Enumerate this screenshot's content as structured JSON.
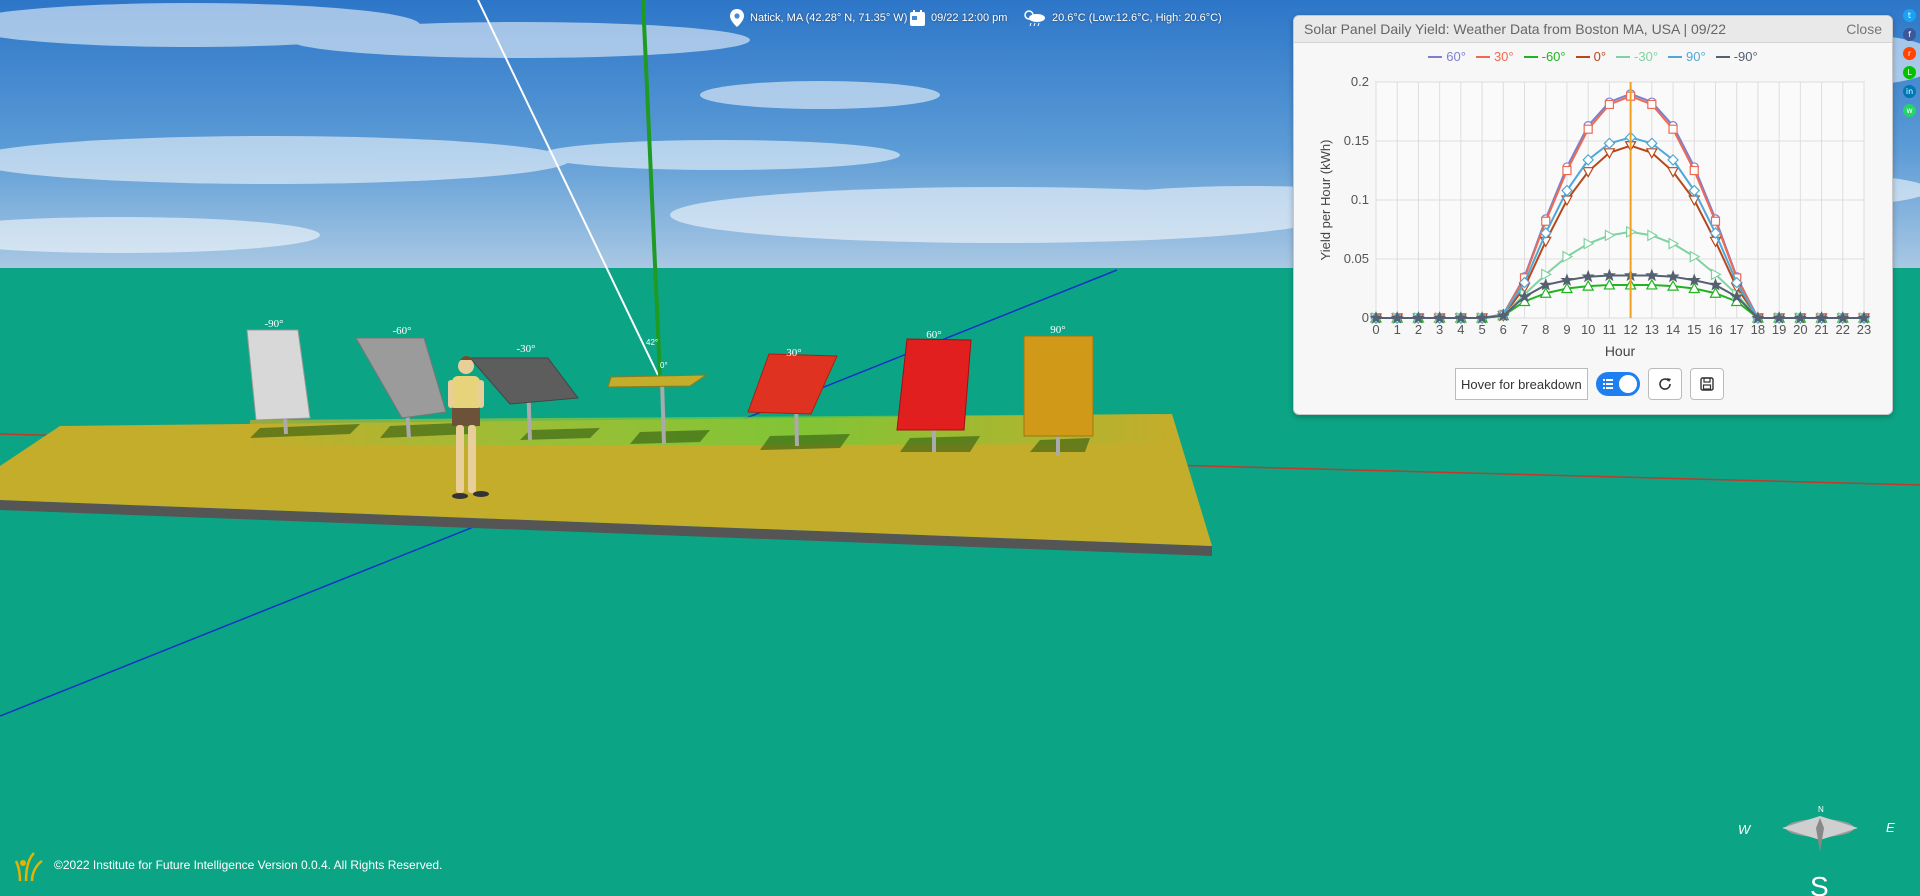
{
  "info": {
    "location": "Natick, MA (42.28° N, 71.35° W)",
    "datetime": "09/22 12:00 pm",
    "weather": "20.6°C (Low:12.6°C, High: 20.6°C)"
  },
  "scene": {
    "panel_labels": [
      "-90°",
      "-60°",
      "-30°",
      "30°",
      "60°",
      "90°"
    ],
    "sun_angle_labels": [
      "42°",
      "0°"
    ],
    "colors": {
      "ground": "#0ba585",
      "platform": "#c3ad2b",
      "sky_top": "#2d76c8",
      "sky_bottom": "#a9c8e3"
    }
  },
  "panel": {
    "title": "Solar Panel Daily Yield: Weather Data from Boston MA, USA | 09/22",
    "close_label": "Close",
    "breakdown_label": "Hover for breakdown",
    "toggle_state": "on"
  },
  "chart_data": {
    "type": "line",
    "xlabel": "Hour",
    "ylabel": "Yield per Hour (kWh)",
    "xlim": [
      0,
      23
    ],
    "ylim": [
      0,
      0.2
    ],
    "x_ticks": [
      "0",
      "1",
      "2",
      "3",
      "4",
      "5",
      "6",
      "7",
      "8",
      "9",
      "10",
      "11",
      "12",
      "13",
      "14",
      "15",
      "16",
      "17",
      "18",
      "19",
      "20",
      "21",
      "22",
      "23"
    ],
    "y_ticks": [
      "0",
      "0.05",
      "0.1",
      "0.15",
      "0.2"
    ],
    "grid": true,
    "legend_position": "top",
    "cursor_hour": 12,
    "x": [
      0,
      1,
      2,
      3,
      4,
      5,
      6,
      7,
      8,
      9,
      10,
      11,
      12,
      13,
      14,
      15,
      16,
      17,
      18,
      19,
      20,
      21,
      22,
      23
    ],
    "series": [
      {
        "name": "60°",
        "color": "#7b7fd0",
        "marker": "circle",
        "values": [
          0,
          0,
          0,
          0,
          0,
          0,
          0.003,
          0.035,
          0.084,
          0.128,
          0.163,
          0.183,
          0.19,
          0.183,
          0.163,
          0.128,
          0.084,
          0.035,
          0,
          0,
          0,
          0,
          0,
          0
        ]
      },
      {
        "name": "30°",
        "color": "#ee6a52",
        "marker": "square",
        "values": [
          0,
          0,
          0,
          0,
          0,
          0,
          0.003,
          0.034,
          0.082,
          0.125,
          0.16,
          0.181,
          0.188,
          0.181,
          0.16,
          0.125,
          0.082,
          0.034,
          0,
          0,
          0,
          0,
          0,
          0
        ]
      },
      {
        "name": "-60°",
        "color": "#22b323",
        "marker": "triangle-up",
        "values": [
          0,
          0,
          0,
          0,
          0,
          0,
          0.002,
          0.014,
          0.021,
          0.025,
          0.027,
          0.028,
          0.028,
          0.028,
          0.027,
          0.025,
          0.021,
          0.014,
          0,
          0,
          0,
          0,
          0,
          0
        ]
      },
      {
        "name": "0°",
        "color": "#b9471a",
        "marker": "triangle-down",
        "values": [
          0,
          0,
          0,
          0,
          0,
          0,
          0.002,
          0.026,
          0.065,
          0.1,
          0.124,
          0.14,
          0.146,
          0.14,
          0.124,
          0.1,
          0.065,
          0.026,
          0,
          0,
          0,
          0,
          0,
          0
        ]
      },
      {
        "name": "-30°",
        "color": "#7fd3a0",
        "marker": "triangle-right",
        "values": [
          0,
          0,
          0,
          0,
          0,
          0,
          0.002,
          0.02,
          0.037,
          0.052,
          0.063,
          0.07,
          0.073,
          0.07,
          0.063,
          0.052,
          0.037,
          0.02,
          0,
          0,
          0,
          0,
          0,
          0
        ]
      },
      {
        "name": "90°",
        "color": "#4fa8d6",
        "marker": "diamond",
        "values": [
          0,
          0,
          0,
          0,
          0,
          0,
          0.003,
          0.03,
          0.072,
          0.108,
          0.134,
          0.148,
          0.153,
          0.148,
          0.134,
          0.108,
          0.072,
          0.03,
          0,
          0,
          0,
          0,
          0,
          0
        ]
      },
      {
        "name": "-90°",
        "color": "#556070",
        "marker": "star",
        "values": [
          0,
          0,
          0,
          0,
          0,
          0,
          0.002,
          0.018,
          0.028,
          0.032,
          0.035,
          0.036,
          0.036,
          0.036,
          0.035,
          0.032,
          0.028,
          0.018,
          0,
          0,
          0,
          0,
          0,
          0
        ]
      }
    ]
  },
  "footer": {
    "copyright": "©2022 Institute for Future Intelligence Version 0.0.4. All Rights Reserved."
  },
  "compass": {
    "n": "N",
    "s": "S",
    "e": "E",
    "w": "W"
  },
  "share": {
    "items": [
      {
        "name": "twitter",
        "color": "#1da1f2",
        "glyph": "t"
      },
      {
        "name": "facebook",
        "color": "#3b5998",
        "glyph": "f"
      },
      {
        "name": "reddit",
        "color": "#ff4500",
        "glyph": "r"
      },
      {
        "name": "line",
        "color": "#00c300",
        "glyph": "L"
      },
      {
        "name": "linkedin",
        "color": "#0077b5",
        "glyph": "in"
      },
      {
        "name": "whatsapp",
        "color": "#25d366",
        "glyph": "w"
      }
    ]
  }
}
